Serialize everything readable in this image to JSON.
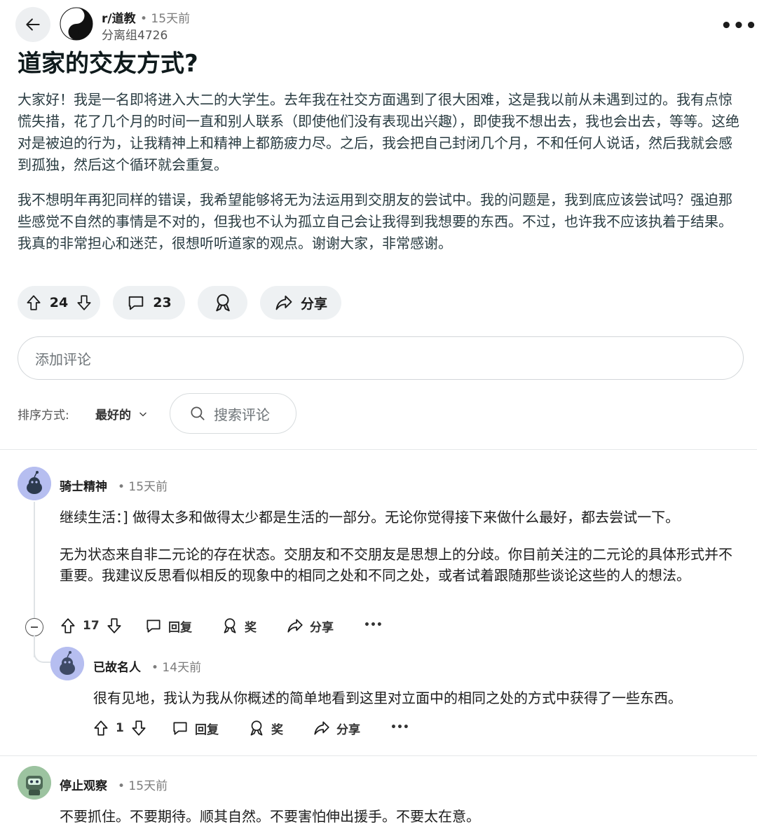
{
  "header": {
    "subreddit": "r/道教",
    "time": "• 15天前",
    "author": "分离组4726",
    "more": "•••"
  },
  "post": {
    "title": "道家的交友方式?",
    "paragraphs": [
      "大家好！我是一名即将进入大二的大学生。去年我在社交方面遇到了很大困难，这是我以前从未遇到过的。我有点惊慌失措，花了几个月的时间一直和别人联系（即使他们没有表现出兴趣），即使我不想出去，我也会出去，等等。这绝对是被迫的行为，让我精神上和精神上都筋疲力尽。之后，我会把自己封闭几个月，不和任何人说话，然后我就会感到孤独，然后这个循环就会重复。",
      "我不想明年再犯同样的错误，我希望能够将无为法运用到交朋友的尝试中。我的问题是，我到底应该尝试吗？强迫那些感觉不自然的事情是不对的，但我也不认为孤立自己会让我得到我想要的东西。不过，也许我不应该执着于结果。我真的非常担心和迷茫，很想听听道家的观点。谢谢大家，非常感谢。"
    ],
    "votes": "24",
    "comments": "23",
    "share_label": "分享"
  },
  "add_comment_placeholder": "添加评论",
  "sort": {
    "label": "排序方式:",
    "value": "最好的"
  },
  "search_comments_placeholder": "搜索评论",
  "comments": [
    {
      "user": "骑士精神",
      "time": "• 15天前",
      "paragraphs": [
        "继续生活：] 做得太多和做得太少都是生活的一部分。无论你觉得接下来做什么最好，都去尝试一下。",
        "无为状态来自非二元论的存在状态。交朋友和不交朋友是思想上的分歧。你目前关注的二元论的具体形式并不重要。我建议反思看似相反的现象中的相同之处和不同之处，或者试着跟随那些谈论这些的人的想法。"
      ],
      "votes": "17",
      "reply_label": "回复",
      "award_label": "奖",
      "share_label": "分享",
      "more": "•••"
    },
    {
      "user": "已故名人",
      "time": "• 14天前",
      "paragraphs": [
        "很有见地，我认为我从你概述的简单地看到这里对立面中的相同之处的方式中获得了一些东西。"
      ],
      "votes": "1",
      "reply_label": "回复",
      "award_label": "奖",
      "share_label": "分享",
      "more": "•••"
    },
    {
      "user": "停止观察",
      "time": "• 15天前",
      "paragraphs": [
        "不要抓住。不要期待。顺其自然。不要害怕伸出援手。不要太在意。"
      ]
    }
  ],
  "colors": {
    "pill_bg": "#eef1f3",
    "avatar_bg": "#b6bef0",
    "text": "#1c1c1c"
  }
}
